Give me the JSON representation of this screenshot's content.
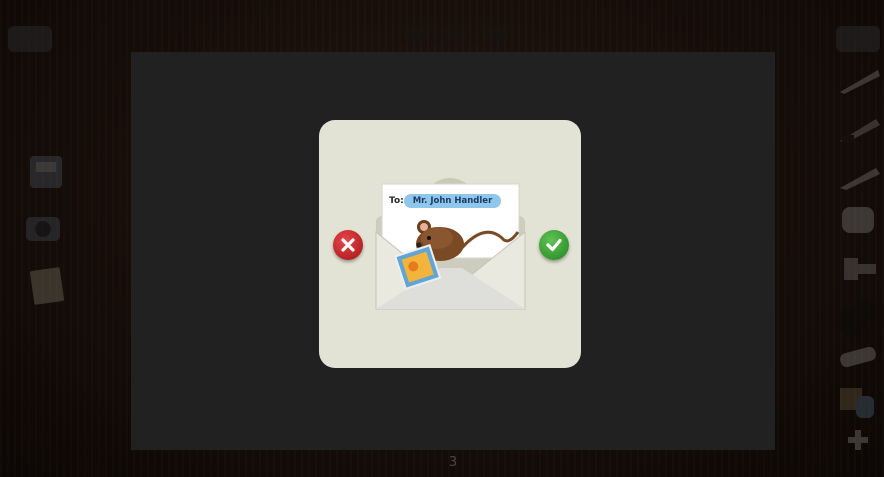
{
  "page": {
    "number": "3"
  },
  "dialog": {
    "to_label": "To:",
    "recipient": "Mr. John Handler",
    "cancel_icon": "close-icon",
    "confirm_icon": "check-icon"
  },
  "colors": {
    "dialog_bg": "#e3e3d5",
    "canvas_bg": "#333333",
    "cancel": "#c8262b",
    "confirm": "#3aa531",
    "recipient_field": "#8ec7ea"
  },
  "toolbar": {
    "left_tools": [
      "phone-icon",
      "camera-icon",
      "notes-icon"
    ],
    "right_tools": [
      "marker-icon",
      "pen-icon",
      "crayon-icon",
      "text-icon",
      "stamp-icon",
      "paint-icon",
      "eraser-icon",
      "hand-icon",
      "plus-icon"
    ]
  }
}
